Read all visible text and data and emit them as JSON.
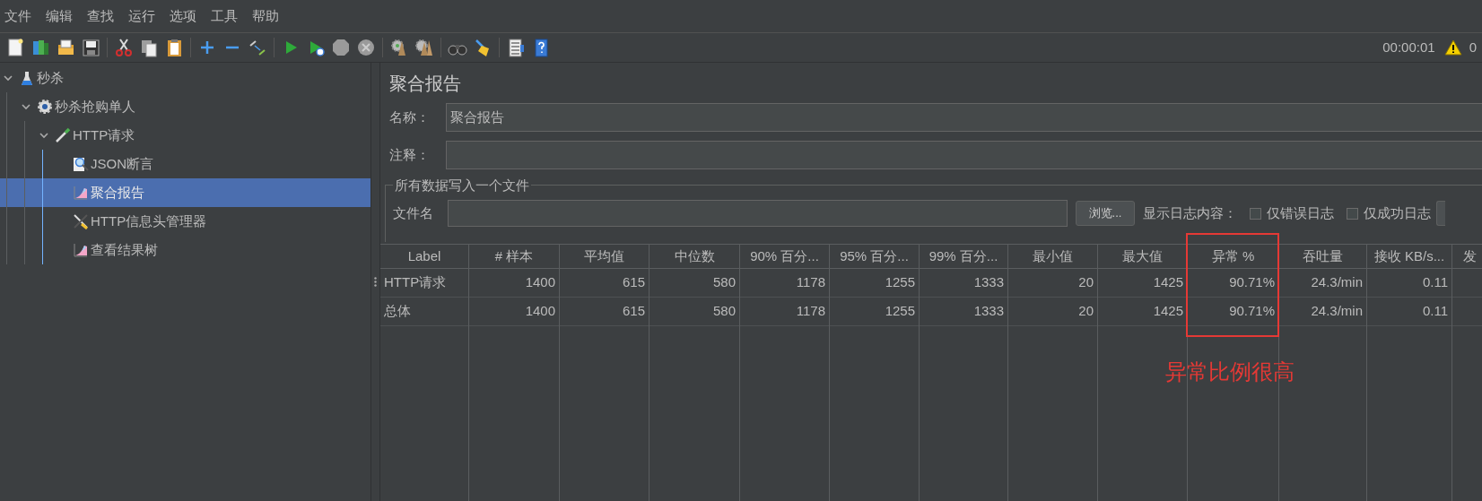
{
  "menu": [
    "文件",
    "编辑",
    "查找",
    "运行",
    "选项",
    "工具",
    "帮助"
  ],
  "toolbar": {
    "timer": "00:00:01",
    "warning_count": "0"
  },
  "tree": [
    {
      "label": "秒杀",
      "kind": "flask",
      "expanded": true,
      "selected": false,
      "children": [
        {
          "label": "秒杀抢购单人",
          "kind": "gear",
          "expanded": true,
          "selected": false,
          "children": [
            {
              "label": "HTTP请求",
              "kind": "pipette",
              "expanded": true,
              "selected": false,
              "children": [
                {
                  "label": "JSON断言",
                  "kind": "magnifier",
                  "selected": false
                },
                {
                  "label": "聚合报告",
                  "kind": "chart",
                  "selected": true
                },
                {
                  "label": "HTTP信息头管理器",
                  "kind": "tools",
                  "selected": false
                },
                {
                  "label": "查看结果树",
                  "kind": "chart",
                  "selected": false
                }
              ]
            }
          ]
        }
      ]
    }
  ],
  "panel": {
    "title": "聚合报告",
    "name_label": "名称：",
    "name_value": "聚合报告",
    "comment_label": "注释：",
    "file_group": {
      "title": "所有数据写入一个文件",
      "filename_label": "文件名",
      "browse_button": "浏览...",
      "log_label": "显示日志内容：",
      "checkboxes": [
        {
          "label": "仅错误日志",
          "checked": false
        },
        {
          "label": "仅成功日志",
          "checked": false
        }
      ]
    }
  },
  "table": {
    "columns": [
      {
        "label": "Label",
        "highlighted": false
      },
      {
        "label": "# 样本",
        "highlighted": false
      },
      {
        "label": "平均值",
        "highlighted": false
      },
      {
        "label": "中位数",
        "highlighted": false
      },
      {
        "label": "90% 百分...",
        "highlighted": false
      },
      {
        "label": "95% 百分...",
        "highlighted": false
      },
      {
        "label": "99% 百分...",
        "highlighted": false
      },
      {
        "label": "最小值",
        "highlighted": false
      },
      {
        "label": "最大值",
        "highlighted": false
      },
      {
        "label": "异常 %",
        "highlighted": true
      },
      {
        "label": "吞吐量",
        "highlighted": false
      },
      {
        "label": "接收 KB/s...",
        "highlighted": false
      },
      {
        "label": "发",
        "highlighted": false
      }
    ],
    "rows": [
      [
        "HTTP请求",
        "1400",
        "615",
        "580",
        "1178",
        "1255",
        "1333",
        "20",
        "1425",
        "90.71%",
        "24.3/min",
        "0.11"
      ],
      [
        "总体",
        "1400",
        "615",
        "580",
        "1178",
        "1255",
        "1333",
        "20",
        "1425",
        "90.71%",
        "24.3/min",
        "0.11"
      ]
    ]
  },
  "annotation": {
    "text": "异常比例很高"
  }
}
